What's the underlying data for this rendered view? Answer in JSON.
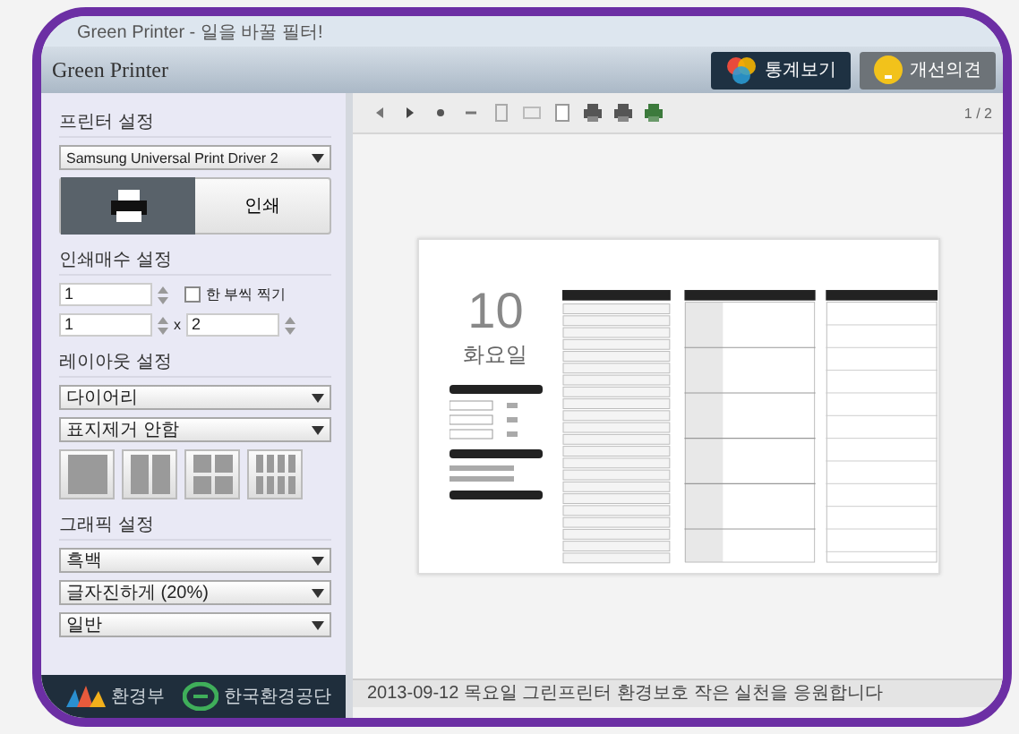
{
  "window": {
    "title": "Green Printer - 일을 바꿀 필터!"
  },
  "header": {
    "logo": "Green Printer",
    "buttons": [
      {
        "label": "통계보기",
        "kind": "stats"
      },
      {
        "label": "개선의견",
        "kind": "idea"
      }
    ]
  },
  "printer_settings": {
    "heading": "프린터 설정",
    "printer": "Samsung Universal Print Driver 2",
    "print_button": "인쇄"
  },
  "copies": {
    "heading": "인쇄매수 설정",
    "copies": "1",
    "collate": {
      "label": "한 부씩 찍기",
      "checked": false
    },
    "rows": "1",
    "times": "x",
    "cols": "2"
  },
  "layout": {
    "heading": "레이아웃 설정",
    "selects": [
      "다이어리",
      "표지제거 안함"
    ],
    "options": [
      {
        "kind": "single"
      },
      {
        "kind": "double"
      },
      {
        "kind": "quad"
      },
      {
        "kind": "octo"
      }
    ]
  },
  "graphics": {
    "heading": "그래픽 설정",
    "selects": [
      "흑백",
      "글자진하게 (20%)",
      "일반"
    ]
  },
  "footer": {
    "logos": [
      {
        "label": "환경부",
        "kind": "ministry"
      },
      {
        "label": "한국환경공단",
        "kind": "agency"
      }
    ]
  },
  "toolbar": {
    "page": "1 / 2"
  },
  "preview": {
    "day": "10",
    "weekday": "화요일"
  },
  "status_bar": "2013-09-12 목요일 그린프린터 환경보호 작은 실천을 응원합니다"
}
